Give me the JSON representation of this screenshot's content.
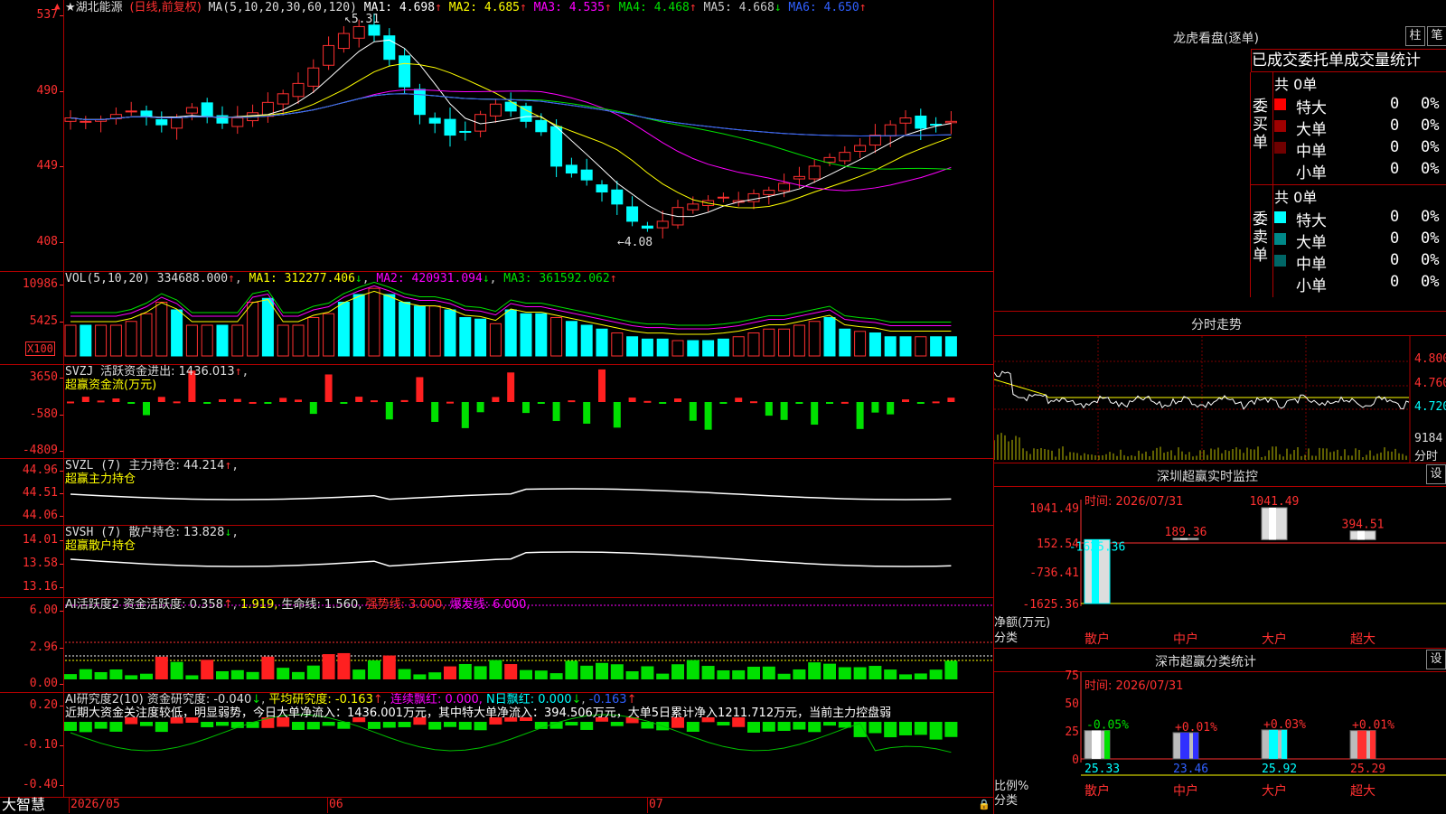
{
  "stock": {
    "name": "★湖北能源",
    "mode": "(日线,前复权)",
    "ma_label": "MA(5,10,20,30,60,120)",
    "ma": [
      {
        "label": "MA1: 4.698",
        "arrow": "↑",
        "color": "#ffffff"
      },
      {
        "label": "MA2: 4.685",
        "arrow": "↑",
        "color": "#ffff00"
      },
      {
        "label": "MA3: 4.535",
        "arrow": "↑",
        "color": "#ff00ff"
      },
      {
        "label": "MA4: 4.468",
        "arrow": "↑",
        "color": "#00e000"
      },
      {
        "label": "MA5: 4.668",
        "arrow": "↓",
        "color": "#c8c8c8"
      },
      {
        "label": "MA6: 4.650",
        "arrow": "↑",
        "color": "#3060ff"
      }
    ],
    "high_label": "5.31",
    "low_label": "4.08",
    "price_ticks": [
      "537",
      "490",
      "449",
      "408"
    ]
  },
  "vol": {
    "header": "VOL(5,10,20)",
    "value": "334688.000",
    "ma1": "MA1: 312277.406",
    "ma2": "MA2: 420931.094",
    "ma3": "MA3: 361592.062",
    "ticks": [
      "10986",
      "5425"
    ],
    "unit": "X100"
  },
  "svzj": {
    "header": "SVZJ",
    "line": "活跃资金进出: 1436.013",
    "sub": "超赢资金流(万元)",
    "ticks": [
      "3650",
      "-580",
      "-4809"
    ]
  },
  "svzl": {
    "header": "SVZL (7)",
    "line": "主力持仓: 44.214",
    "sub": "超赢主力持仓",
    "ticks": [
      "44.96",
      "44.51",
      "44.06"
    ]
  },
  "svsh": {
    "header": "SVSH (7)",
    "line": "散户持仓: 13.828",
    "sub": "超赢散户持仓",
    "ticks": [
      "14.01",
      "13.58",
      "13.16"
    ]
  },
  "ai1": {
    "header": "AI活跃度2",
    "a": "资金活跃度: 0.358",
    "b": "1.919,",
    "c": "生命线: 1.560,",
    "d": "强势线: 3.000,",
    "e": "爆发线: 6.000,",
    "ticks": [
      "6.00",
      "2.96",
      "0.00"
    ]
  },
  "ai2": {
    "header": "AI研究度2(10)",
    "a": "资金研究度: -0.040",
    "b": "平均研究度: -0.163",
    "c": "连续飘红: 0.000,",
    "d": "N日飘红: 0.000",
    "e": "-0.163",
    "comment": "近期大资金关注度较低，明显弱势，今日大单净流入：1436.001万元，其中特大单净流入：394.506万元，大单5日累计净入1211.712万元，当前主力控盘弱",
    "ticks": [
      "0.20",
      "-0.10",
      "-0.40"
    ]
  },
  "xaxis": {
    "logo": "大智慧",
    "labels": [
      "2026/05",
      "06",
      "07"
    ]
  },
  "right": {
    "lhb_title": "龙虎看盘(逐单)",
    "btn_bar": "柱",
    "btn_pen": "笔",
    "tabs": [
      "已成交",
      "委托单",
      "成交量",
      "统计"
    ],
    "buy": {
      "side": "委买单",
      "total": "共 0单",
      "rows": [
        {
          "name": "特大",
          "n": "0",
          "p": "0%",
          "color": "#ff0000"
        },
        {
          "name": "大单",
          "n": "0",
          "p": "0%",
          "color": "#a00000"
        },
        {
          "name": "中单",
          "n": "0",
          "p": "0%",
          "color": "#700000"
        },
        {
          "name": "小单",
          "n": "0",
          "p": "0%",
          "color": ""
        }
      ]
    },
    "sell": {
      "side": "委卖单",
      "total": "共 0单",
      "rows": [
        {
          "name": "特大",
          "n": "0",
          "p": "0%",
          "color": "#00ffff"
        },
        {
          "name": "大单",
          "n": "0",
          "p": "0%",
          "color": "#008888"
        },
        {
          "name": "中单",
          "n": "0",
          "p": "0%",
          "color": "#006666"
        },
        {
          "name": "小单",
          "n": "0",
          "p": "0%",
          "color": ""
        }
      ]
    },
    "intraday": {
      "title": "分时走势",
      "ticks": [
        "4.800",
        "4.760",
        "4.720"
      ],
      "vol_tick": "9184",
      "vol_label": "分时"
    },
    "monitor": {
      "title": "深圳超赢实时监控",
      "btn": "设",
      "time": "时间: 2026/07/31",
      "ticks": [
        "1041.49",
        "152.54",
        "-736.41",
        "-1625.36"
      ],
      "ylabel": "净额(万元)",
      "xlabel": "分类",
      "cats": [
        "散户",
        "中户",
        "大户",
        "超大"
      ],
      "values": [
        -1625.36,
        189.36,
        1041.49,
        394.51
      ],
      "value_labels": [
        "-1625.36",
        "189.36",
        "1041.49",
        "394.51"
      ]
    },
    "classstat": {
      "title": "深市超赢分类统计",
      "btn": "设",
      "time": "时间: 2026/07/31",
      "ticks": [
        "75",
        "50",
        "25",
        "0"
      ],
      "ylabel": "比例%",
      "xlabel": "分类",
      "cats": [
        "散户",
        "中户",
        "大户",
        "超大"
      ],
      "values": [
        25.33,
        23.46,
        25.92,
        25.29
      ],
      "changes": [
        "-0.05%",
        "+0.01%",
        "+0.03%",
        "+0.01%"
      ],
      "value_labels": [
        "25.33",
        "23.46",
        "25.92",
        "25.29"
      ]
    }
  }
}
